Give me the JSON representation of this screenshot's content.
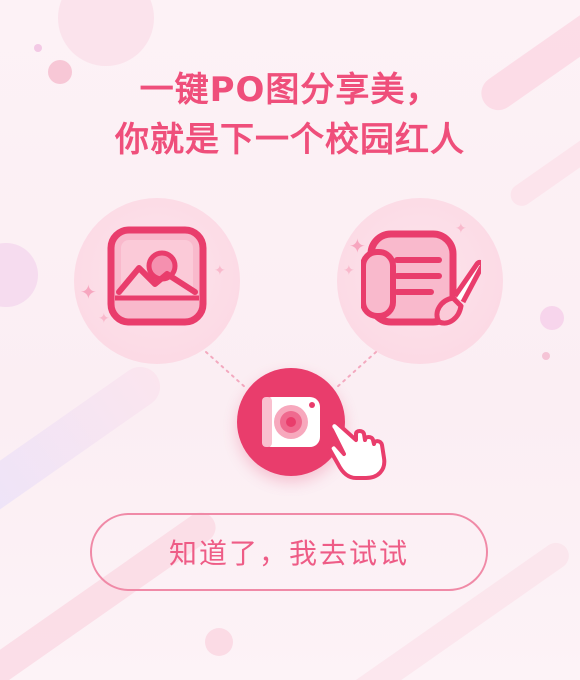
{
  "headline": {
    "line1": "一键PO图分享美，",
    "line2": "你就是下一个校园红人"
  },
  "features": {
    "left_icon": "image-icon",
    "right_icon": "edit-notes-icon",
    "center_icon": "camera-icon",
    "pointer_icon": "hand-pointer-icon"
  },
  "cta": {
    "label": "知道了，我去试试"
  },
  "colors": {
    "accent": "#e93d6c",
    "headline": "#ef4f7b",
    "cta_text": "#ee5c86",
    "background": "#fdf2f6"
  }
}
